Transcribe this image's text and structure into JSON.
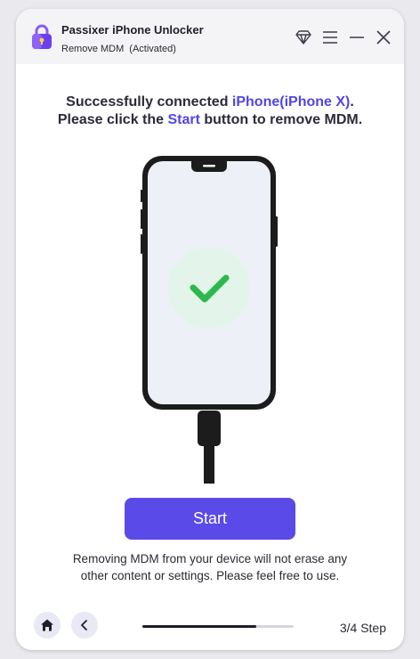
{
  "app": {
    "title": "Passixer iPhone Unlocker",
    "mode": "Remove MDM",
    "status": "(Activated)"
  },
  "icons": {
    "logo": "padlock-icon",
    "premium": "diamond-icon",
    "menu": "menu-icon",
    "minimize": "minimize-icon",
    "close": "close-icon",
    "home": "home-icon",
    "back": "chevron-left-icon",
    "success": "checkmark-icon"
  },
  "headline": {
    "line1_prefix": "Successfully connected ",
    "device": "iPhone(iPhone X)",
    "line1_suffix": ".",
    "line2_prefix": "Please click the ",
    "start_word": "Start",
    "line2_suffix": " button to remove MDM."
  },
  "start_button_label": "Start",
  "note": {
    "line1": "Removing MDM from your device will not erase any",
    "line2": "other content or settings. Please feel free to use."
  },
  "footer": {
    "progress": 0.75,
    "step_label": "3/4 Step"
  },
  "colors": {
    "accent": "#5046e5",
    "button": "#5a4ae8",
    "success": "#2db84b"
  }
}
